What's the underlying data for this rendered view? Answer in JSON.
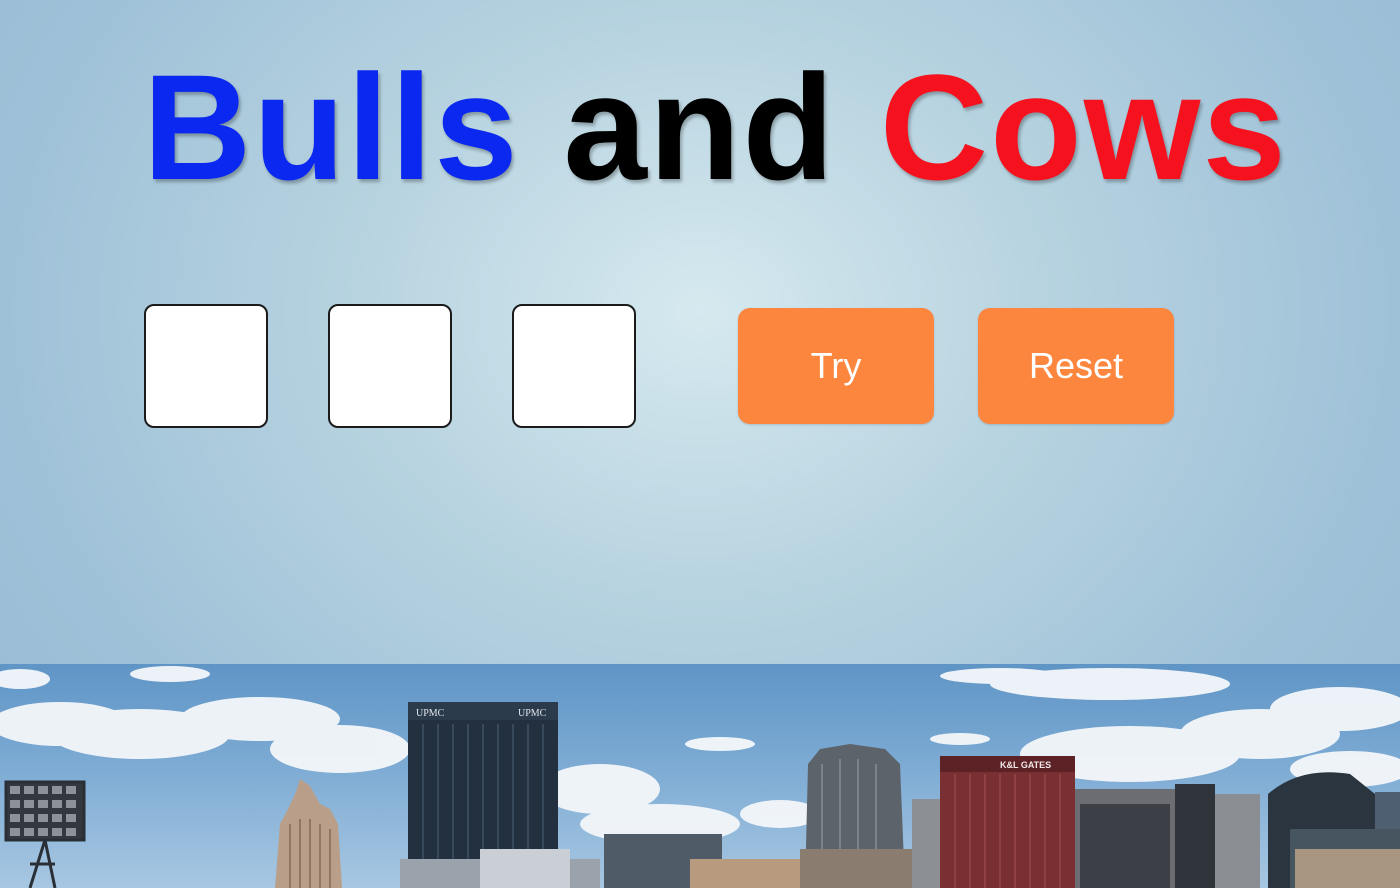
{
  "title": {
    "word1": "Bulls",
    "word2": "and",
    "word3": "Cows",
    "colors": {
      "word1": "#0a28f0",
      "word2": "#000000",
      "word3": "#f5121e"
    }
  },
  "guess": {
    "digits": [
      "",
      "",
      ""
    ]
  },
  "buttons": {
    "try_label": "Try",
    "reset_label": "Reset",
    "color": "#fd863e"
  },
  "background": {
    "sky_color": "#a6c6dc",
    "skyline_signs": [
      "UPMC",
      "UPMC",
      "K&L GATES"
    ]
  }
}
